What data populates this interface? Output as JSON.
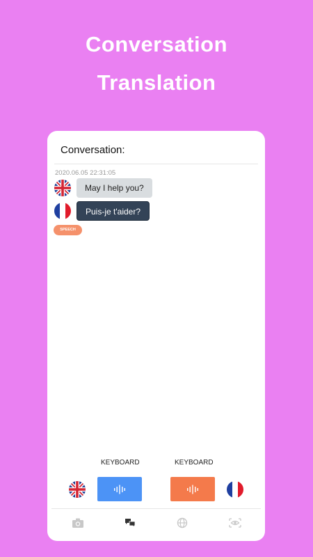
{
  "hero": {
    "line1": "Conversation",
    "line2": "Translation"
  },
  "card": {
    "title": "Conversation:",
    "timestamp": "2020.06.05 22:31:05",
    "messages": [
      {
        "lang": "uk-flag-icon",
        "text": "May I help you?"
      },
      {
        "lang": "france-flag-icon",
        "text": "Puis-je t'aider?"
      }
    ],
    "speech_tag": "SPEECH"
  },
  "controls": {
    "left_keyboard_label": "KEYBOARD",
    "right_keyboard_label": "KEYBOARD"
  },
  "colors": {
    "background": "#ea80f2",
    "blue_button": "#4c93f6",
    "orange_button": "#f47a4b",
    "fr_bubble": "#334357",
    "en_bubble": "#d9dde0"
  },
  "tabs": [
    "camera-icon",
    "conversation-icon",
    "globe-icon",
    "eye-icon"
  ]
}
